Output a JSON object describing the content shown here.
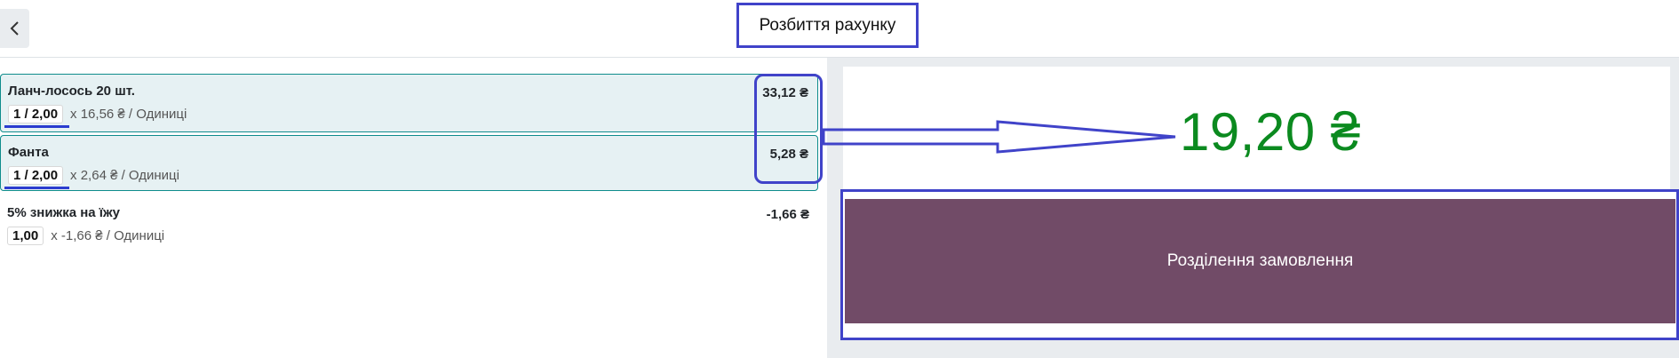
{
  "header": {
    "title": "Розбиття рахунку",
    "back_icon": "chevron-left-icon"
  },
  "order_lines": [
    {
      "name": "Ланч-лосось 20 шт.",
      "qty": "1 / 2,00",
      "unit_info": "x 16,56 ₴ / Одиниці",
      "price": "33,12 ₴",
      "selected": true
    },
    {
      "name": "Фанта",
      "qty": "1 / 2,00",
      "unit_info": "x 2,64 ₴ / Одиниці",
      "price": "5,28 ₴",
      "selected": true
    },
    {
      "name": "5% знижка на їжу",
      "qty": "1,00",
      "unit_info": "x -1,66 ₴ / Одиниці",
      "price": "-1,66 ₴",
      "selected": false
    }
  ],
  "summary": {
    "total": "19,20 ₴",
    "split_button_label": "Розділення замовлення"
  },
  "colors": {
    "accent": "#714b67",
    "total": "#0b8a1f",
    "selected_bg": "#e6f1f3",
    "highlight": "#4043c9"
  }
}
